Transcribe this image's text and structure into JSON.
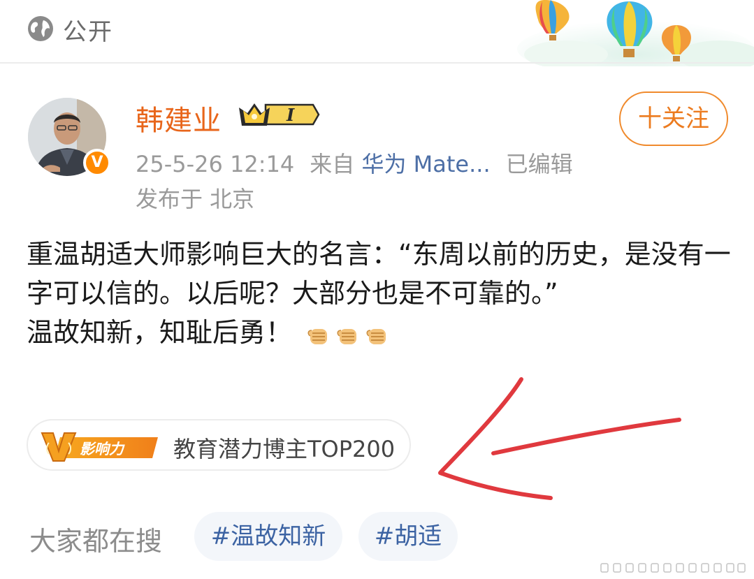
{
  "header": {
    "visibility_icon": "globe-icon",
    "visibility_label": "公开"
  },
  "author": {
    "name": "韩建业",
    "badge_level": "I",
    "verified_mark": "V",
    "follow_label": "十关注"
  },
  "meta": {
    "timestamp": "25-5-26 12:14",
    "source_prefix": "来自",
    "device": "华为 Mate...",
    "edited": "已编辑",
    "location": "发布于 北京"
  },
  "post": {
    "lines": [
      "重温胡适大师影响巨大的名言：“东周以前的历史，是没有一字可以信的。以后呢？大部分也是不可靠的。”",
      "温故知新，知耻后勇！"
    ],
    "emojis": [
      "fist-emoji",
      "fist-emoji",
      "fist-emoji"
    ]
  },
  "influence": {
    "badge_v": "V",
    "badge_text": "影响力",
    "rank_label": "教育潜力博主TOP200"
  },
  "search": {
    "label": "大家都在搜",
    "tags": [
      "#温故知新",
      "#胡适"
    ]
  },
  "colors": {
    "accent_orange": "#e8651a",
    "link_blue": "#4d6fa6",
    "tag_blue": "#3c63a3",
    "annotation_red": "#e0393e"
  }
}
